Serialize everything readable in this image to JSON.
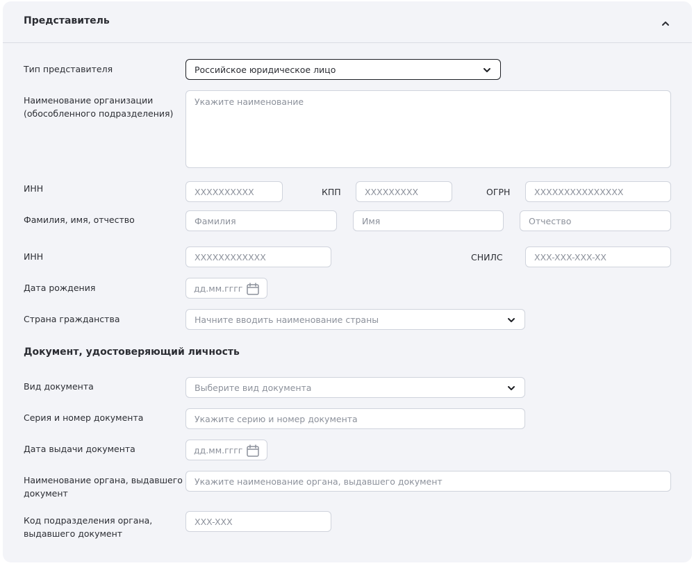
{
  "header": {
    "title": "Представитель"
  },
  "representative": {
    "type_label": "Тип представителя",
    "type_value": "Российское юридическое лицо",
    "org_name_label_1": "Наименование организации",
    "org_name_label_2": "(обособленного подразделения)",
    "org_name_placeholder": "Укажите наименование",
    "inn_label": "ИНН",
    "inn_placeholder": "XXXXXXXXXX",
    "kpp_label": "КПП",
    "kpp_placeholder": "XXXXXXXXX",
    "ogrn_label": "ОГРН",
    "ogrn_placeholder": "XXXXXXXXXXXXXXX",
    "fio_label": "Фамилия, имя, отчество",
    "surname_placeholder": "Фамилия",
    "name_placeholder": "Имя",
    "patronymic_placeholder": "Отчество",
    "person_inn_label": "ИНН",
    "person_inn_placeholder": "XXXXXXXXXXXX",
    "snils_label": "СНИЛС",
    "snils_placeholder": "XXX-XXX-XXX-XX",
    "birth_label": "Дата рождения",
    "birth_placeholder": "дд.мм.гггг",
    "country_label": "Страна гражданства",
    "country_placeholder": "Начните вводить наименование страны"
  },
  "document": {
    "section_title": "Документ, удостоверяющий личность",
    "kind_label": "Вид документа",
    "kind_placeholder": "Выберите вид документа",
    "number_label": "Серия и номер документа",
    "number_placeholder": "Укажите серию и номер документа",
    "issue_date_label": "Дата выдачи документа",
    "issue_date_placeholder": "дд.мм.гггг",
    "issuer_label_1": "Наименование органа, выдавшего",
    "issuer_label_2": "документ",
    "issuer_placeholder": "Укажите наименование органа, выдавшего документ",
    "dept_code_label_1": "Код подразделения органа,",
    "dept_code_label_2": "выдавшего документ",
    "dept_code_placeholder": "XXX-XXX"
  },
  "icons": {
    "collapse": "chevron-up-icon",
    "dropdown": "chevron-down-icon",
    "calendar": "calendar-icon"
  }
}
